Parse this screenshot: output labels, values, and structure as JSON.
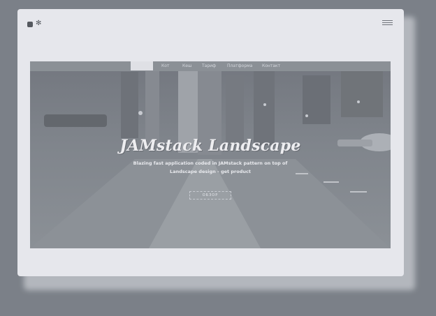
{
  "nav": {
    "items": [
      {
        "label": ""
      },
      {
        "label": "Кот"
      },
      {
        "label": "Кеш"
      },
      {
        "label": "Тариф"
      },
      {
        "label": "Платформа"
      },
      {
        "label": "Контакт"
      }
    ]
  },
  "hero": {
    "title": "JAMstack Landscape",
    "subtitle": "Blazing fast application coded in JAMstack pattern on top of Landscape design - get product",
    "cta_label": "ОБЗОР"
  },
  "icons": {
    "window_dot": "square-icon",
    "window_gear": "gear-icon",
    "menu": "hamburger-menu-icon"
  },
  "colors": {
    "page_bg": "#7b8088",
    "window_bg": "#e6e7ec",
    "nav_bg": "#8b9096",
    "nav_active": "#dfe0e5",
    "hero_text": "#ededf0"
  }
}
